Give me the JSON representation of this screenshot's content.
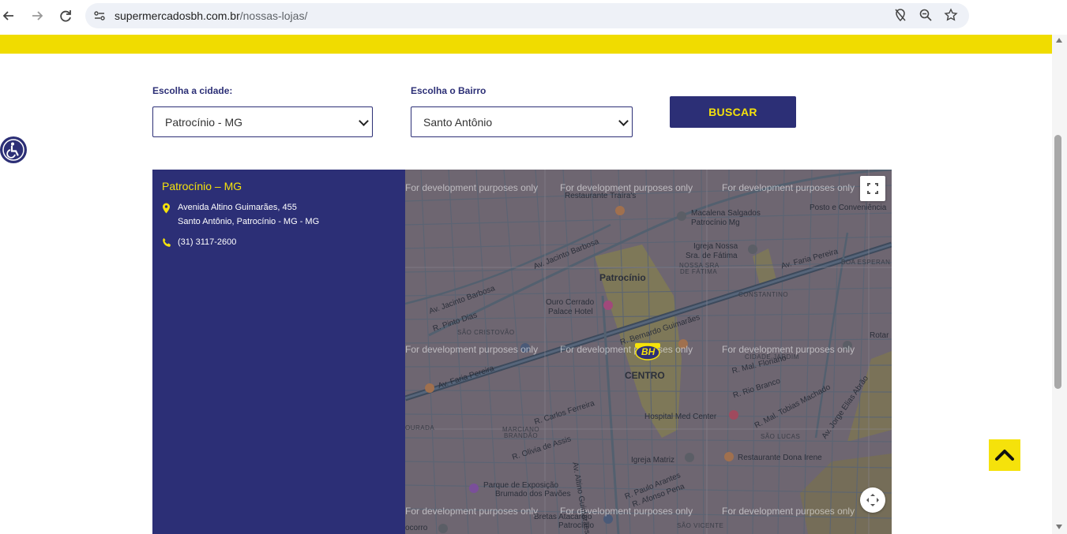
{
  "browser": {
    "back_icon": "arrow-left-icon",
    "forward_icon": "arrow-right-icon",
    "reload_icon": "reload-icon",
    "url_domain": "supermercadosbh.com.br",
    "url_path": "/nossas-lojas/",
    "right_icons": [
      "location-off-icon",
      "zoom-icon",
      "star-icon"
    ]
  },
  "search": {
    "city_label": "Escolha a cidade:",
    "city_value": "Patrocínio - MG",
    "neighborhood_label": "Escolha o Bairro",
    "neighborhood_value": "Santo Antônio",
    "button_label": "BUSCAR"
  },
  "store": {
    "city_title": "Patrocínio – MG",
    "address_line1": "Avenida Altino Guimarães, 455",
    "address_line2": "Santo Antônio, Patrocínio - MG - MG",
    "phone": "(31) 3117-2600"
  },
  "map": {
    "watermark": "For development purposes only",
    "marker_text": "BH",
    "labels": {
      "restaurante_trairas": "Restaurante Traíra's",
      "macalena": "Macalena Salgados",
      "macalena2": "Patrocínio Mg",
      "igreja_fatima1": "Igreja Nossa",
      "igreja_fatima2": "Sra. de Fátima",
      "patrocinio": "Patrocínio",
      "ouro_cerrado1": "Ouro Cerrado",
      "ouro_cerrado2": "Palace Hotel",
      "centro": "CENTRO",
      "hospital": "Hospital Med Center",
      "igreja_matriz": "Igreja Matriz",
      "restaurante_dona": "Restaurante Dona Irene",
      "parque1": "Parque de Exposição",
      "parque2": "Brumado dos Pavões",
      "bretas": "Bretas Atacarejo",
      "bretas2": "Patrocínio",
      "posto": "Posto e Conveniência",
      "constantino": "CONSTANTINO",
      "cidade_jardim": "CIDADE JARDIM",
      "sao_cristovao": "SÃO CRISTOVÃO",
      "sao_lucas": "SÃO LUCAS",
      "marciano": "MARCIANO",
      "brandao": "BRANDÃO",
      "sao_vicente": "SÃO VICENTE",
      "nossa_fatima": "NOSSA SRA",
      "nossa_fatima2": "DE FÁTIMA",
      "boa_esperanca": "BOA ESPERAN",
      "rotar": "Rotar",
      "av_faria_pereira": "Av. Faria Pereira",
      "av_faria_pereira_right": "Av. Faria Pereira",
      "av_jacinto": "Av. Jacinto Barbosa",
      "av_jacinto_top": "Av. Jacinto Barbosa",
      "av_altino": "Av. Altino Guimarães",
      "r_mal_floriano": "R. Mal. Floriano",
      "r_rio_branco": "R. Rio Branco",
      "r_carlos_ferreira": "R. Carlos Ferreira",
      "r_olivia": "R. Olivia de Assis",
      "r_pinto_dias": "R. Pinto Dias",
      "r_bernardo": "R. Bernardo Guimarães",
      "r_paulo_arantes": "R. Paulo Arantes",
      "r_afonso": "R. Afonso Pena",
      "r_tobias": "R. Mal. Tobias Machado",
      "av_jorge": "Av. Jorge Elias Abrão",
      "ourada": "OURADA",
      "corro": "ocorro"
    },
    "fullscreen_icon": "fullscreen-icon",
    "camera_control_icon": "camera-control-icon"
  },
  "ui": {
    "accessibility_icon": "accessibility-icon",
    "back_to_top_icon": "chevron-up-icon"
  },
  "colors": {
    "navy": "#2c2f76",
    "yellow": "#f5e20b",
    "band_yellow": "#f0dc00"
  }
}
